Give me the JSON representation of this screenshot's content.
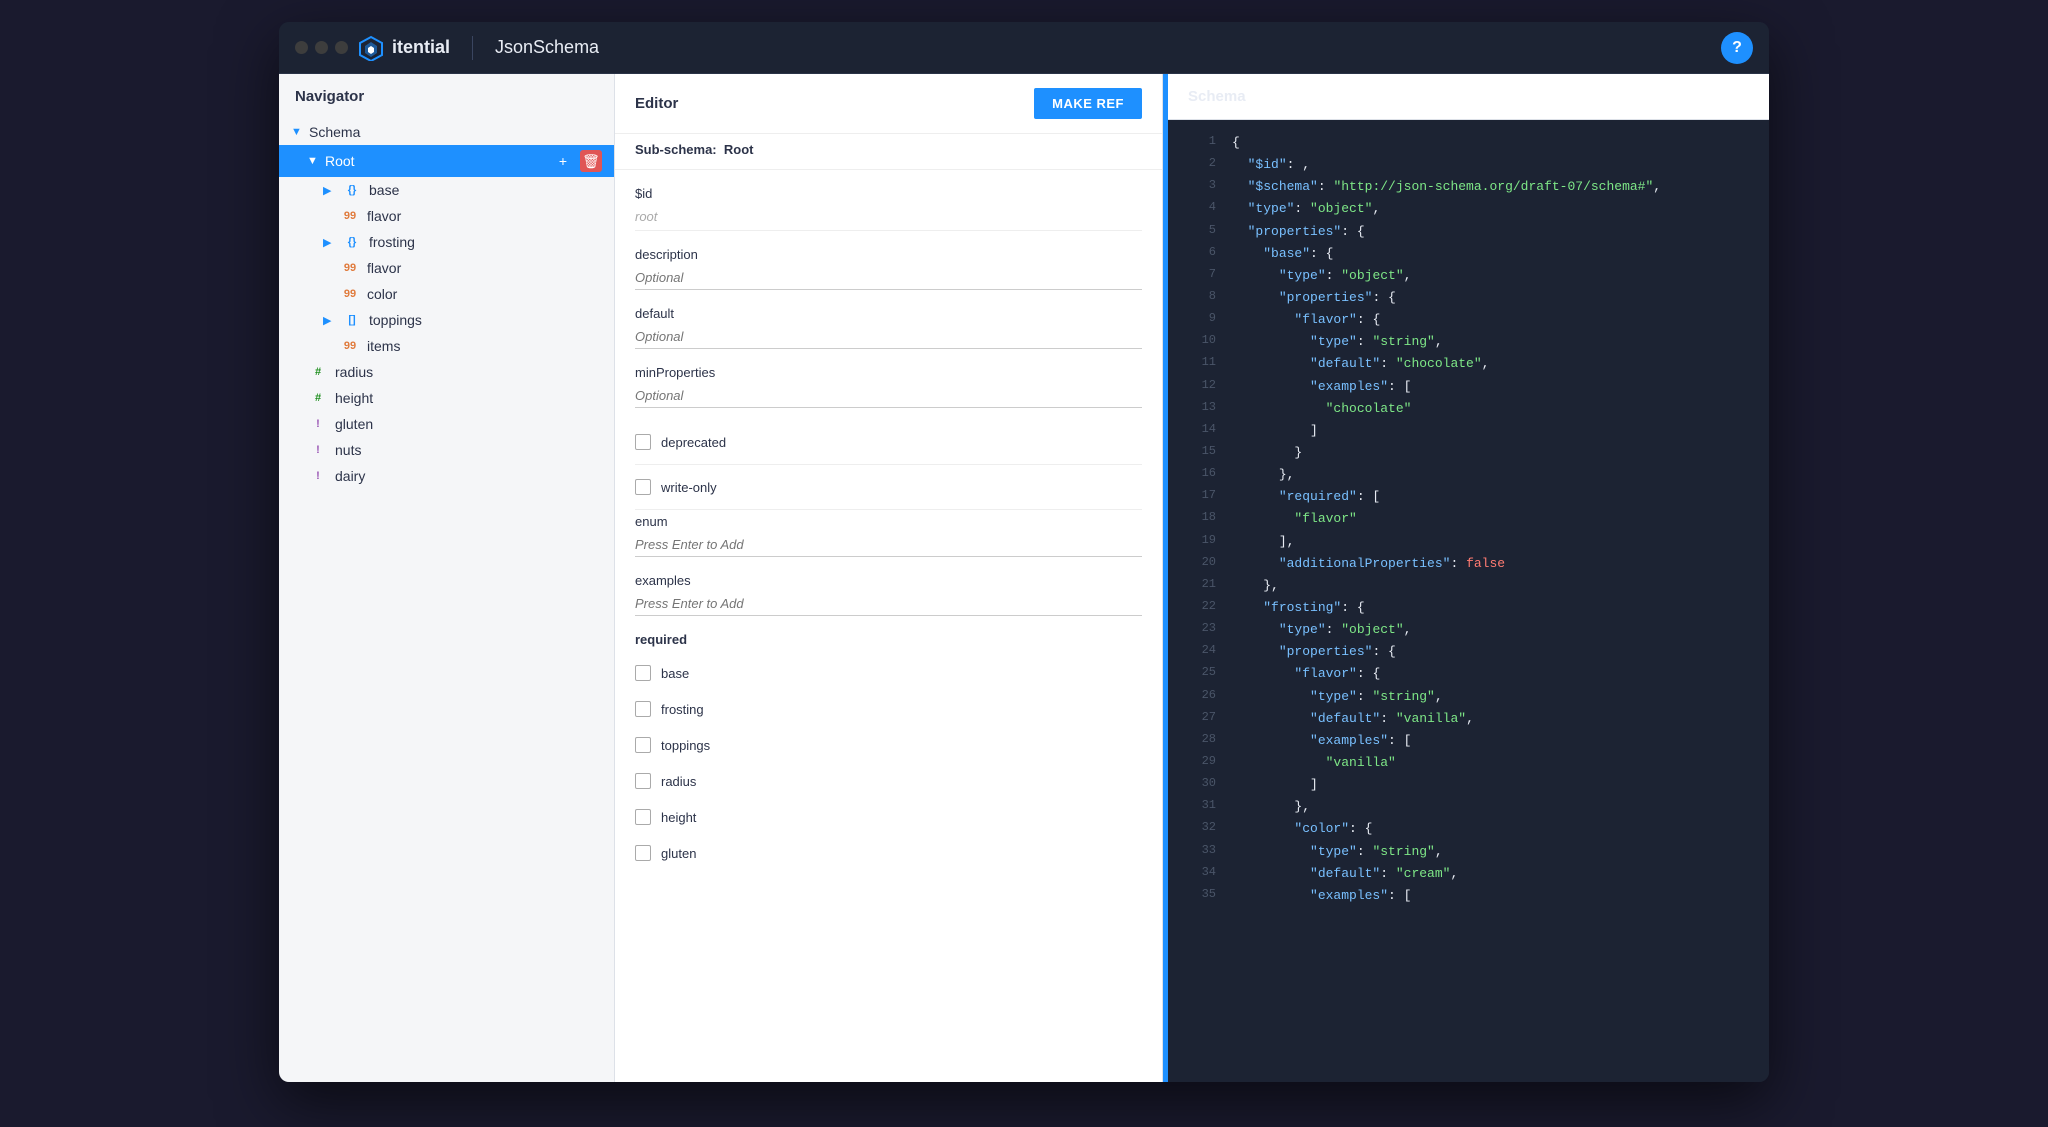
{
  "window": {
    "title": "JsonSchema"
  },
  "titlebar": {
    "app_name": "itential",
    "app_subtitle": "JsonSchema",
    "help_label": "?"
  },
  "navigator": {
    "header": "Navigator",
    "tree": [
      {
        "id": "schema",
        "label": "Schema",
        "level": 0,
        "type": "section",
        "arrow": "▼",
        "active": false
      },
      {
        "id": "root",
        "label": "Root",
        "level": 1,
        "type": "section",
        "arrow": "▼",
        "active": true,
        "has_actions": true
      },
      {
        "id": "base",
        "label": "base",
        "level": 2,
        "type": "obj",
        "type_label": "{}",
        "arrow": "▶"
      },
      {
        "id": "flavor-1",
        "label": "flavor",
        "level": 3,
        "type": "str",
        "type_label": "99"
      },
      {
        "id": "frosting",
        "label": "frosting",
        "level": 2,
        "type": "obj",
        "type_label": "{}",
        "arrow": "▶"
      },
      {
        "id": "flavor-2",
        "label": "flavor",
        "level": 3,
        "type": "str",
        "type_label": "99"
      },
      {
        "id": "color",
        "label": "color",
        "level": 3,
        "type": "str",
        "type_label": "99"
      },
      {
        "id": "toppings",
        "label": "toppings",
        "level": 2,
        "type": "arr",
        "type_label": "[]",
        "arrow": "▶"
      },
      {
        "id": "items",
        "label": "items",
        "level": 3,
        "type": "str",
        "type_label": "99"
      },
      {
        "id": "radius",
        "label": "radius",
        "level": 1,
        "type": "num",
        "type_label": "#"
      },
      {
        "id": "height",
        "label": "height",
        "level": 1,
        "type": "num",
        "type_label": "#"
      },
      {
        "id": "gluten",
        "label": "gluten",
        "level": 1,
        "type": "bool",
        "type_label": "!"
      },
      {
        "id": "nuts",
        "label": "nuts",
        "level": 1,
        "type": "bool",
        "type_label": "!"
      },
      {
        "id": "dairy",
        "label": "dairy",
        "level": 1,
        "type": "bool",
        "type_label": "!"
      }
    ]
  },
  "editor": {
    "header": "Editor",
    "make_ref_label": "MAKE REF",
    "sub_schema_label": "Sub-schema:",
    "sub_schema_value": "Root",
    "fields": {
      "id_label": "$id",
      "id_value": "root",
      "description_label": "description",
      "description_placeholder": "Optional",
      "default_label": "default",
      "default_placeholder": "Optional",
      "min_properties_label": "minProperties",
      "min_properties_placeholder": "Optional",
      "deprecated_label": "deprecated",
      "write_only_label": "write-only",
      "enum_label": "enum",
      "enum_placeholder": "Press Enter to Add",
      "examples_label": "examples",
      "examples_placeholder": "Press Enter to Add",
      "required_label": "required"
    },
    "required_items": [
      "base",
      "frosting",
      "toppings",
      "radius",
      "height",
      "gluten"
    ]
  },
  "schema": {
    "header": "Schema",
    "lines": [
      {
        "num": 1,
        "content": "{"
      },
      {
        "num": 2,
        "content": "  \"$id\": ,"
      },
      {
        "num": 3,
        "content": "  \"$schema\": \"http://json-schema.org/draft-07/schema#\","
      },
      {
        "num": 4,
        "content": "  \"type\": \"object\","
      },
      {
        "num": 5,
        "content": "  \"properties\": {"
      },
      {
        "num": 6,
        "content": "    \"base\": {"
      },
      {
        "num": 7,
        "content": "      \"type\": \"object\","
      },
      {
        "num": 8,
        "content": "      \"properties\": {"
      },
      {
        "num": 9,
        "content": "        \"flavor\": {"
      },
      {
        "num": 10,
        "content": "          \"type\": \"string\","
      },
      {
        "num": 11,
        "content": "          \"default\": \"chocolate\","
      },
      {
        "num": 12,
        "content": "          \"examples\": ["
      },
      {
        "num": 13,
        "content": "            \"chocolate\""
      },
      {
        "num": 14,
        "content": "          ]"
      },
      {
        "num": 15,
        "content": "        }"
      },
      {
        "num": 16,
        "content": "      },"
      },
      {
        "num": 17,
        "content": "      \"required\": ["
      },
      {
        "num": 18,
        "content": "        \"flavor\""
      },
      {
        "num": 19,
        "content": "      ],"
      },
      {
        "num": 20,
        "content": "      \"additionalProperties\": false"
      },
      {
        "num": 21,
        "content": "    },"
      },
      {
        "num": 22,
        "content": "    \"frosting\": {"
      },
      {
        "num": 23,
        "content": "      \"type\": \"object\","
      },
      {
        "num": 24,
        "content": "      \"properties\": {"
      },
      {
        "num": 25,
        "content": "        \"flavor\": {"
      },
      {
        "num": 26,
        "content": "          \"type\": \"string\","
      },
      {
        "num": 27,
        "content": "          \"default\": \"vanilla\","
      },
      {
        "num": 28,
        "content": "          \"examples\": ["
      },
      {
        "num": 29,
        "content": "            \"vanilla\""
      },
      {
        "num": 30,
        "content": "          ]"
      },
      {
        "num": 31,
        "content": "        },"
      },
      {
        "num": 32,
        "content": "        \"color\": {"
      },
      {
        "num": 33,
        "content": "          \"type\": \"string\","
      },
      {
        "num": 34,
        "content": "          \"default\": \"cream\","
      },
      {
        "num": 35,
        "content": "          \"examples\": ["
      }
    ]
  }
}
